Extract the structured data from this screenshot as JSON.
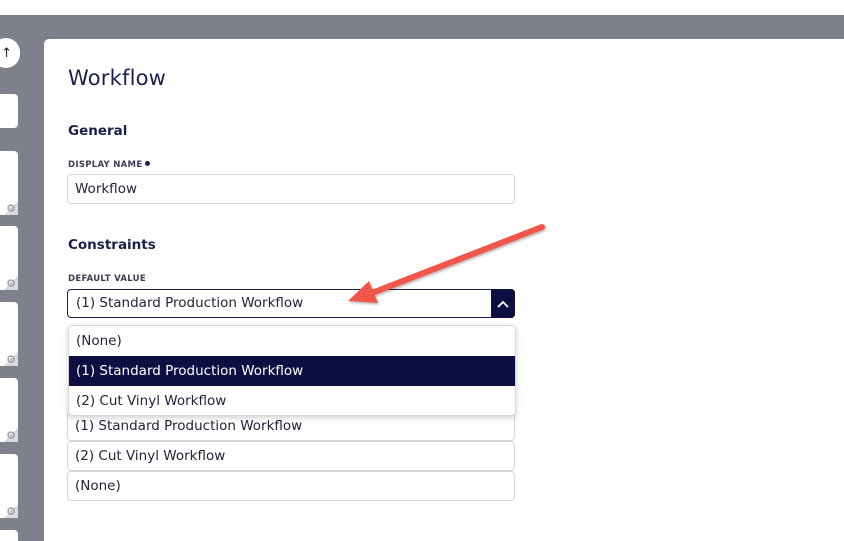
{
  "page": {
    "title": "Workflow"
  },
  "general": {
    "heading": "General",
    "display_name_label": "DISPLAY NAME",
    "display_name_value": "Workflow"
  },
  "constraints": {
    "heading": "Constraints",
    "default_value_label": "DEFAULT VALUE",
    "default_value_selected": "(1) Standard Production Workflow",
    "dropdown_options": [
      "(None)",
      "(1) Standard Production Workflow",
      "(2) Cut Vinyl Workflow"
    ],
    "selected_option_index": 1,
    "option_list": [
      "(1) Standard Production Workflow",
      "(2) Cut Vinyl Workflow",
      "(None)"
    ]
  },
  "icons": {
    "chevron": "chevron-up-icon",
    "gear": "gear-icon",
    "sort": "sort-icon"
  },
  "colors": {
    "navy": "#0d0f42",
    "backdrop": "#7e808b",
    "annotation_arrow": "#f0564a"
  }
}
